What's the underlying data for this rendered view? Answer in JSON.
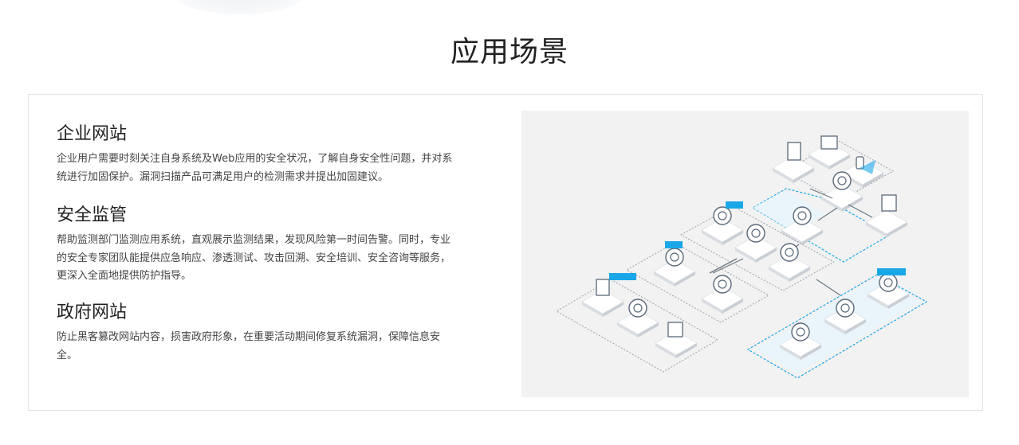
{
  "section": {
    "title": "应用场景"
  },
  "scenes": [
    {
      "title": "企业网站",
      "desc": "企业用户需要时刻关注自身系统及Web应用的安全状况，了解自身安全性问题，并对系统进行加固保护。漏洞扫描产品可满足用户的检测需求并提出加固建议。"
    },
    {
      "title": "安全监管",
      "desc": "帮助监测部门监测应用系统，直观展示监测结果，发现风险第一时间告警。同时，专业的安全专家团队能提供应急响应、渗透测试、攻击回溯、安全培训、安全咨询等服务，更深入全面地提供防护指导。"
    },
    {
      "title": "政府网站",
      "desc": "防止黑客篡改网站内容，损害政府形象，在重要活动期间修复系统漏洞，保障信息安全。"
    }
  ],
  "colors": {
    "accent": "#1aa7e8",
    "panel": "#f2f2f2",
    "tile": "#ffffff",
    "tileSide": "#d9dde1"
  }
}
